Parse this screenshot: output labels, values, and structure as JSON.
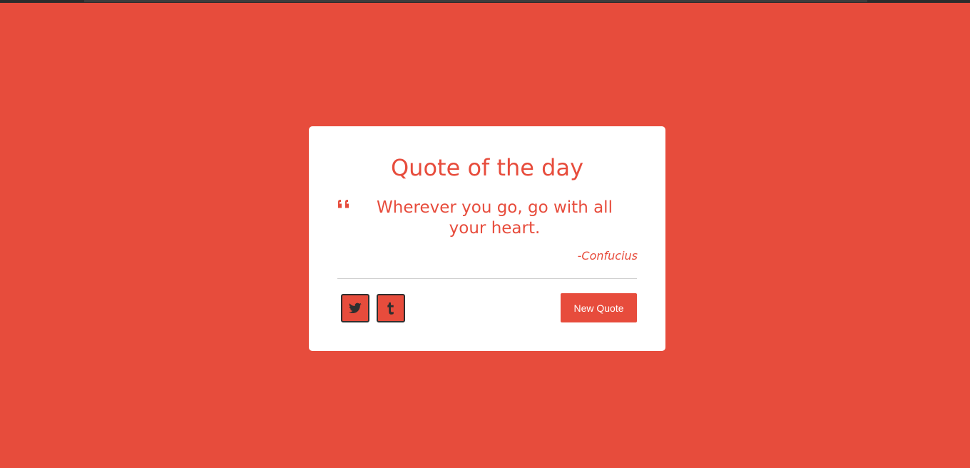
{
  "colors": {
    "background": "#e74c3c",
    "accent": "#e74c3c",
    "card": "#ffffff",
    "icon": "#2f2f2f"
  },
  "card": {
    "title": "Quote of the day",
    "quote_icon": "quote-left-icon",
    "quote": "Wherever you go, go with all your heart.",
    "author": "-Confucius"
  },
  "actions": {
    "twitter_icon": "twitter-icon",
    "tumblr_icon": "tumblr-icon",
    "new_quote_label": "New Quote"
  }
}
